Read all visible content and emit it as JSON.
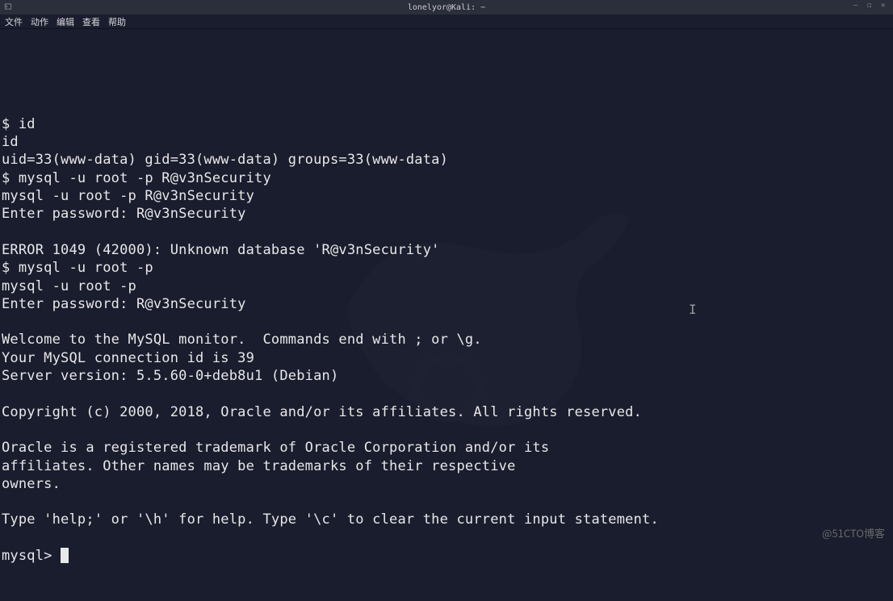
{
  "titlebar": {
    "title": "lonelyor@Kali: ~"
  },
  "menubar": {
    "items": [
      "文件",
      "动作",
      "编辑",
      "查看",
      "帮助"
    ]
  },
  "terminal": {
    "lines": [
      "$ id",
      "id",
      "uid=33(www-data) gid=33(www-data) groups=33(www-data)",
      "$ mysql -u root -p R@v3nSecurity",
      "mysql -u root -p R@v3nSecurity",
      "Enter password: R@v3nSecurity",
      "",
      "ERROR 1049 (42000): Unknown database 'R@v3nSecurity'",
      "$ mysql -u root -p",
      "mysql -u root -p",
      "Enter password: R@v3nSecurity",
      "",
      "Welcome to the MySQL monitor.  Commands end with ; or \\g.",
      "Your MySQL connection id is 39",
      "Server version: 5.5.60-0+deb8u1 (Debian)",
      "",
      "Copyright (c) 2000, 2018, Oracle and/or its affiliates. All rights reserved.",
      "",
      "Oracle is a registered trademark of Oracle Corporation and/or its",
      "affiliates. Other names may be trademarks of their respective",
      "owners.",
      "",
      "Type 'help;' or '\\h' for help. Type '\\c' to clear the current input statement.",
      ""
    ],
    "prompt": "mysql> "
  },
  "watermark": "@51CTO博客"
}
